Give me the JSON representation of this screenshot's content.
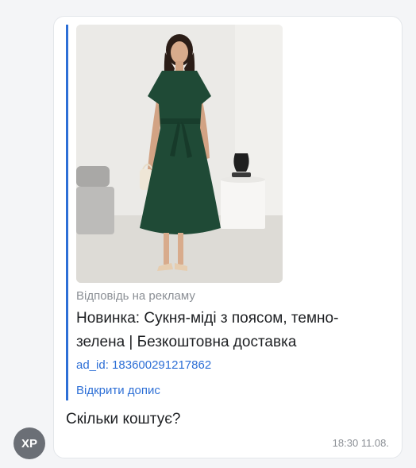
{
  "sender": {
    "initials": "ХР"
  },
  "ad": {
    "image_alt": "Woman in dark green midi dress with belt",
    "source_label": "Відповідь на рекламу",
    "title": "Новинка: Сукня-міді з поясом, темно-зелена | Безкоштовна доставка",
    "ad_id": "ad_id: 183600291217862",
    "open_post_label": "Відкрити допис"
  },
  "message": {
    "text": "Скільки коштує?",
    "time": "18:30 11.08."
  },
  "colors": {
    "accent": "#2d6fd6",
    "dress": "#1f4a36",
    "avatar": "#6b6f76"
  }
}
